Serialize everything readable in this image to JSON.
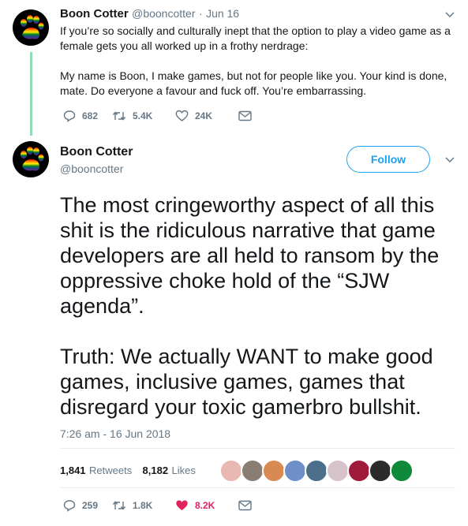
{
  "reply_tweet": {
    "name": "Boon Cotter",
    "handle": "@booncotter",
    "separator": "·",
    "date": "Jun 16",
    "paragraph1": "If you’re so socially and culturally inept that the option to play a video game as a female gets you all worked up in a frothy nerdrage:",
    "paragraph2": "My name is Boon, I make games, but not for people like you. Your kind is done, mate. Do everyone a favour and fuck off. You’re embarrassing.",
    "replies": "682",
    "retweets": "5.4K",
    "likes": "24K"
  },
  "main_tweet": {
    "name": "Boon Cotter",
    "handle": "@booncotter",
    "follow_label": "Follow",
    "paragraph1": "The most cringeworthy aspect of all this shit is the ridiculous narrative that game developers are all held to ransom by the oppressive choke hold of the “SJW agenda”.",
    "paragraph2": "Truth: We actually WANT to make good games, inclusive games, games that disregard your toxic gamerbro bullshit.",
    "timestamp": "7:26 am - 16 Jun 2018",
    "retweet_count": "1,841",
    "retweet_label": "Retweets",
    "like_count": "8,182",
    "like_label": "Likes",
    "replies": "259",
    "retweets": "1.8K",
    "likes": "8.2K"
  },
  "colors": {
    "accent": "#1da1f2",
    "like_red": "#e0245e",
    "thread_line": "#8fdcb8",
    "muted": "#657786"
  }
}
